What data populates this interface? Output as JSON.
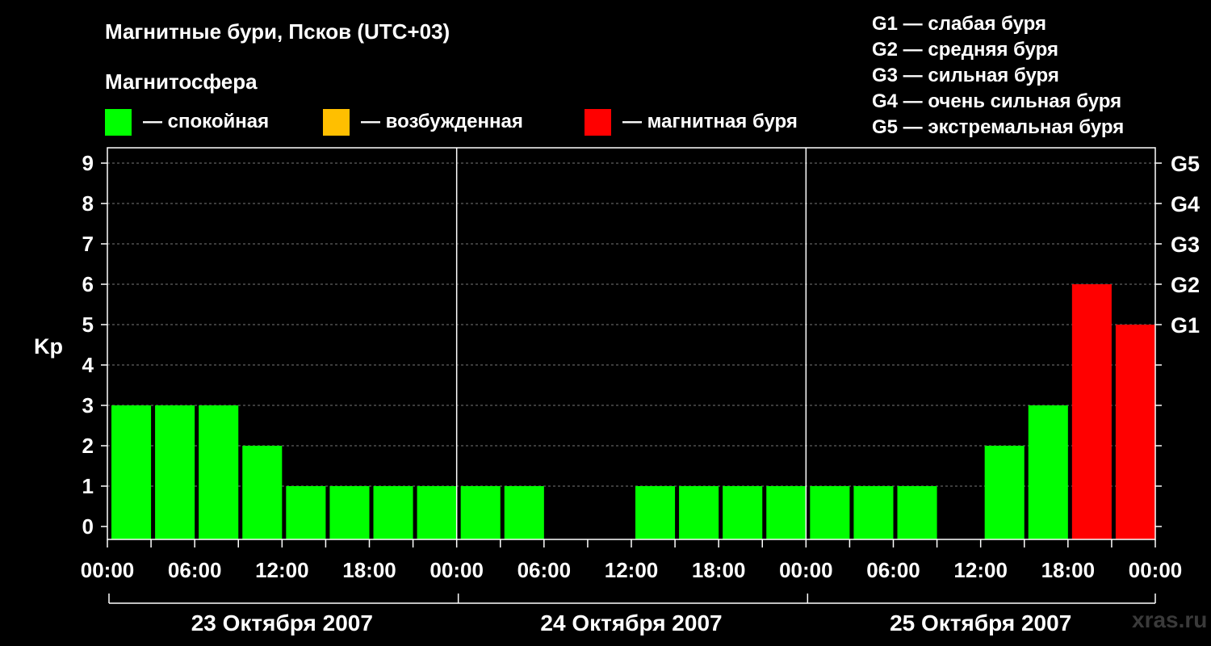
{
  "header": {
    "title": "Магнитные бури, Псков (UTC+03)",
    "subtitle": "Магнитосфера"
  },
  "legend": [
    {
      "label": "— спокойная",
      "color": "#00ff00"
    },
    {
      "label": "— возбужденная",
      "color": "#ffbf00"
    },
    {
      "label": "— магнитная буря",
      "color": "#ff0000"
    }
  ],
  "storm_levels": [
    "G1 — слабая буря",
    "G2 — средняя буря",
    "G3 — сильная буря",
    "G4 — очень сильная буря",
    "G5 — экстремальная буря"
  ],
  "watermark": "xras.ru",
  "chart_data": {
    "type": "bar",
    "ylabel": "Kp",
    "ylim": [
      0,
      9
    ],
    "y_ticks": [
      "0",
      "1",
      "2",
      "3",
      "4",
      "5",
      "6",
      "7",
      "8",
      "9"
    ],
    "right_axis_labels": [
      {
        "kp": 5,
        "label": "G1"
      },
      {
        "kp": 6,
        "label": "G2"
      },
      {
        "kp": 7,
        "label": "G3"
      },
      {
        "kp": 8,
        "label": "G4"
      },
      {
        "kp": 9,
        "label": "G5"
      }
    ],
    "x_tick_labels": [
      "00:00",
      "06:00",
      "12:00",
      "18:00",
      "00:00",
      "06:00",
      "12:00",
      "18:00",
      "00:00",
      "06:00",
      "12:00",
      "18:00",
      "00:00"
    ],
    "days": [
      "23 Октября 2007",
      "24 Октября 2007",
      "25 Октября 2007"
    ],
    "interval_hours": 3,
    "values": [
      3,
      3,
      3,
      2,
      1,
      1,
      1,
      1,
      1,
      1,
      0,
      0,
      1,
      1,
      1,
      1,
      1,
      1,
      1,
      0,
      2,
      3,
      6,
      5
    ],
    "colors": [
      "#00ff00",
      "#00ff00",
      "#00ff00",
      "#00ff00",
      "#00ff00",
      "#00ff00",
      "#00ff00",
      "#00ff00",
      "#00ff00",
      "#00ff00",
      "#00ff00",
      "#00ff00",
      "#00ff00",
      "#00ff00",
      "#00ff00",
      "#00ff00",
      "#00ff00",
      "#00ff00",
      "#00ff00",
      "#00ff00",
      "#00ff00",
      "#00ff00",
      "#ff0000",
      "#ff0000"
    ],
    "grid": true
  }
}
